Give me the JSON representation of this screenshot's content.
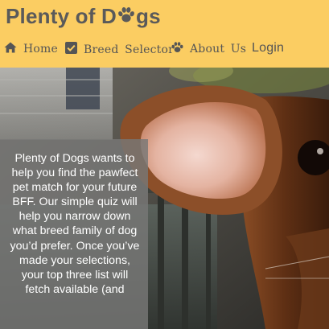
{
  "header": {
    "brand_prefix": "Plenty of D",
    "brand_suffix": "gs",
    "brand_logo_icon": "paw-icon",
    "background_color": "#fbcd62",
    "text_color": "#5a5a5a"
  },
  "nav": {
    "items": [
      {
        "label": "Home",
        "icon": "home-icon"
      },
      {
        "label": "Breed Selector",
        "icon": "checkbox-icon"
      },
      {
        "label": "About Us",
        "icon": "paw-icon"
      },
      {
        "label": "Login"
      }
    ]
  },
  "hero": {
    "image_icon": "dog-ear-photo"
  },
  "intro": {
    "text": "Plenty of Dogs wants to help you find the pawfect pet match for your future BFF. Our simple quiz will help you narrow down what breed family of dog you’d prefer. Once you’ve made your selections, your top three list will fetch available (and"
  }
}
